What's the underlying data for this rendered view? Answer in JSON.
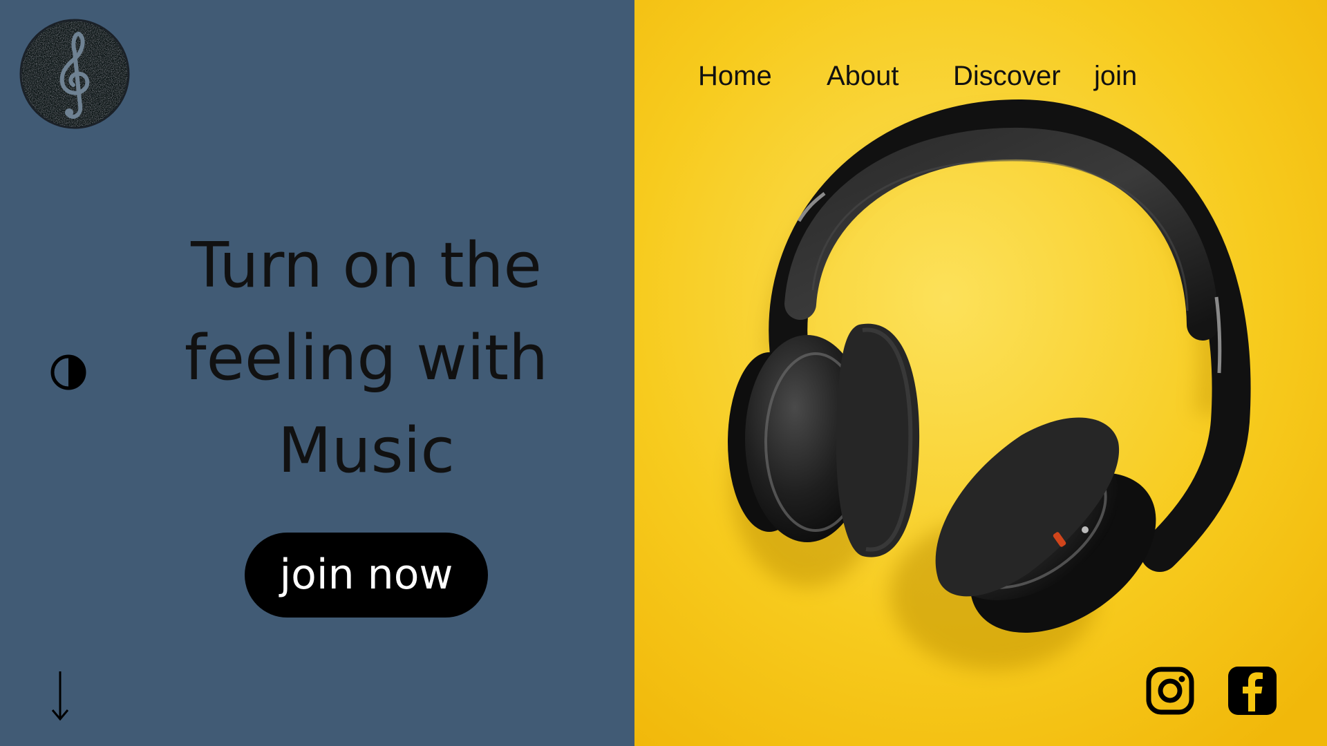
{
  "brand": {
    "logo_icon": "treble-clef-icon",
    "left_bg": "#415B75",
    "right_bg": "#F6C60F",
    "accent": "#000000"
  },
  "nav": {
    "items": [
      {
        "label": "Home"
      },
      {
        "label": "About"
      },
      {
        "label": "Discover"
      },
      {
        "label": "join"
      }
    ]
  },
  "hero": {
    "title_lines": [
      "Turn on the",
      "feeling with",
      "Music"
    ],
    "cta_label": "join now"
  },
  "controls": {
    "contrast_icon": "contrast-toggle-icon",
    "scroll_icon": "arrow-down-icon"
  },
  "social": {
    "items": [
      {
        "icon": "instagram-icon"
      },
      {
        "icon": "facebook-icon"
      }
    ]
  }
}
